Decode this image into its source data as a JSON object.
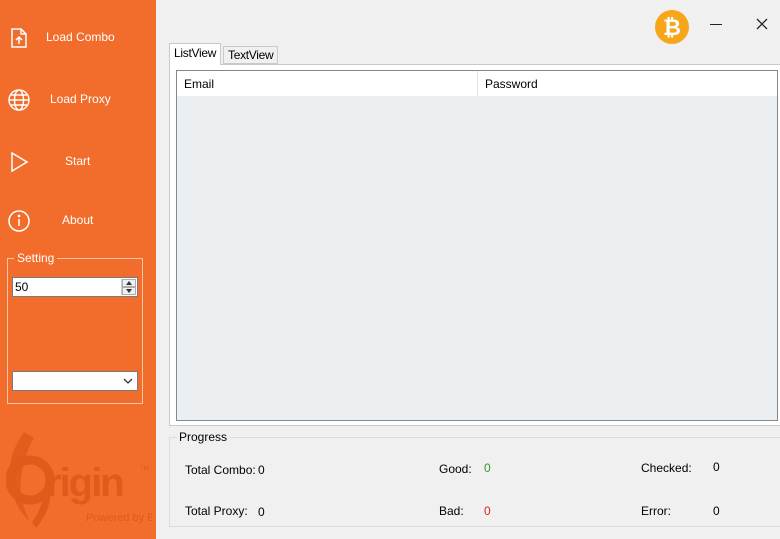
{
  "sidebar": {
    "items": [
      {
        "label": "Load Combo",
        "icon": "upload-file-icon"
      },
      {
        "label": "Load Proxy",
        "icon": "globe-icon"
      },
      {
        "label": "Start",
        "icon": "play-icon"
      },
      {
        "label": "About",
        "icon": "info-icon"
      }
    ],
    "setting": {
      "title": "Setting",
      "threads_value": "50",
      "select_value": ""
    },
    "logo": {
      "name": "Origin",
      "tagline": "Powered by EA"
    }
  },
  "titlebar": {
    "icons": [
      "bitcoin-icon",
      "minimize-icon",
      "close-icon"
    ]
  },
  "tabs": [
    {
      "label": "ListView",
      "active": true
    },
    {
      "label": "TextView",
      "active": false
    }
  ],
  "listview": {
    "columns": [
      "Email",
      "Password"
    ],
    "rows": []
  },
  "progress": {
    "title": "Progress",
    "total_combo": {
      "label": "Total Combo:",
      "value": "0"
    },
    "total_proxy": {
      "label": "Total Proxy:",
      "value": "0"
    },
    "good": {
      "label": "Good:",
      "value": "0"
    },
    "bad": {
      "label": "Bad:",
      "value": "0"
    },
    "checked": {
      "label": "Checked:",
      "value": "0"
    },
    "error": {
      "label": "Error:",
      "value": "0"
    }
  },
  "colors": {
    "sidebar": "#f26d2b",
    "bitcoin": "#f7a61b",
    "good": "#2e9a2e",
    "bad": "#e02020"
  }
}
